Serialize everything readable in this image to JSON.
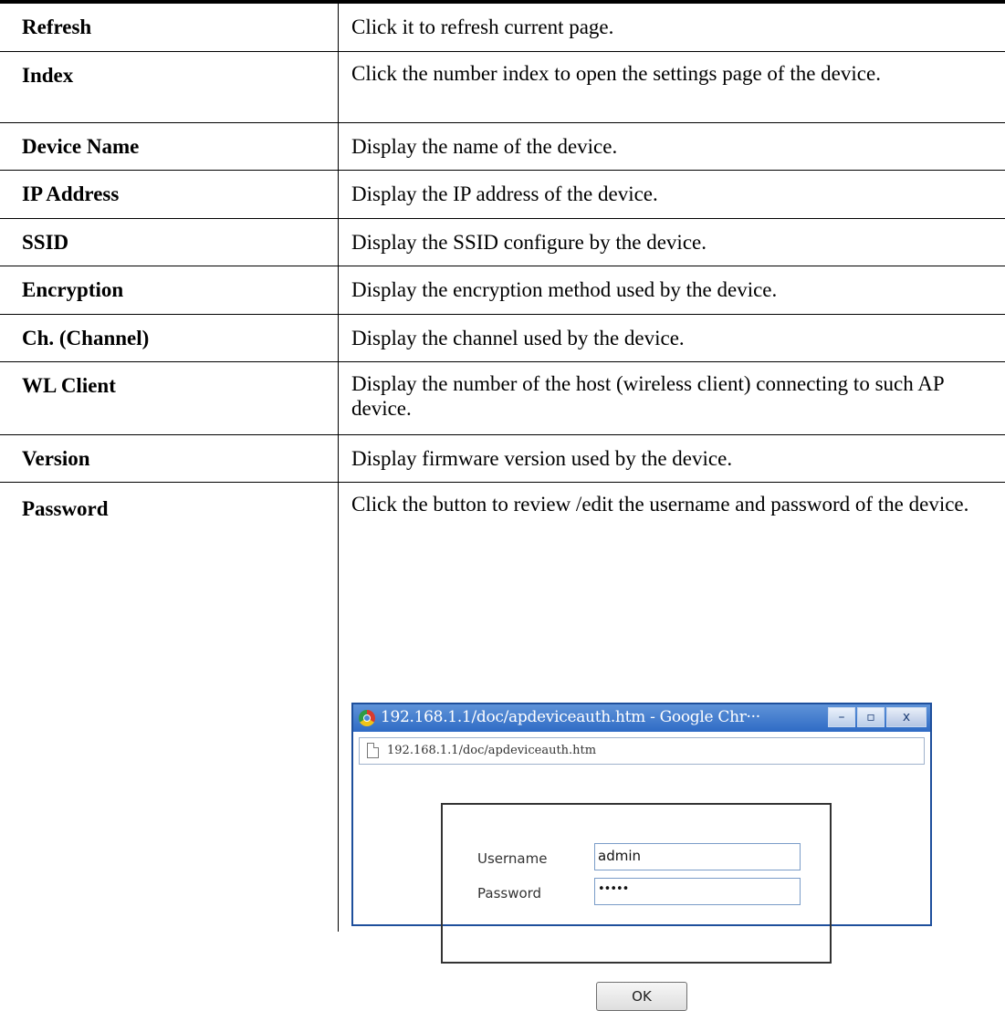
{
  "rows": [
    {
      "term": "Refresh",
      "desc": "Click it to refresh current page."
    },
    {
      "term": "Index",
      "desc": "Click the number index to open the settings page of the device."
    },
    {
      "term": "Device Name",
      "desc": "Display the name of the device."
    },
    {
      "term": "IP Address",
      "desc": "Display the IP address of the device."
    },
    {
      "term": "SSID",
      "desc": "Display the SSID configure by the device."
    },
    {
      "term": "Encryption",
      "desc": "Display the encryption method used by the device."
    },
    {
      "term": "Ch. (Channel)",
      "desc": "Display the channel used by the device."
    },
    {
      "term": "WL Client",
      "desc": "Display the number of the host (wireless client) connecting to such AP device."
    },
    {
      "term": "Version",
      "desc": "Display firmware version used by the device."
    },
    {
      "term": "Password",
      "desc": "Click the button to review /edit the username and password of the device."
    }
  ],
  "popup": {
    "title": "192.168.1.1/doc/apdeviceauth.htm - Google Chr···",
    "url": "192.168.1.1/doc/apdeviceauth.htm",
    "buttons": {
      "minimize": "–",
      "maximize": "▫",
      "close": "x"
    },
    "username_label": "Username",
    "username_value": "admin",
    "password_label": "Password",
    "password_value": "•••••",
    "ok_label": "OK"
  }
}
